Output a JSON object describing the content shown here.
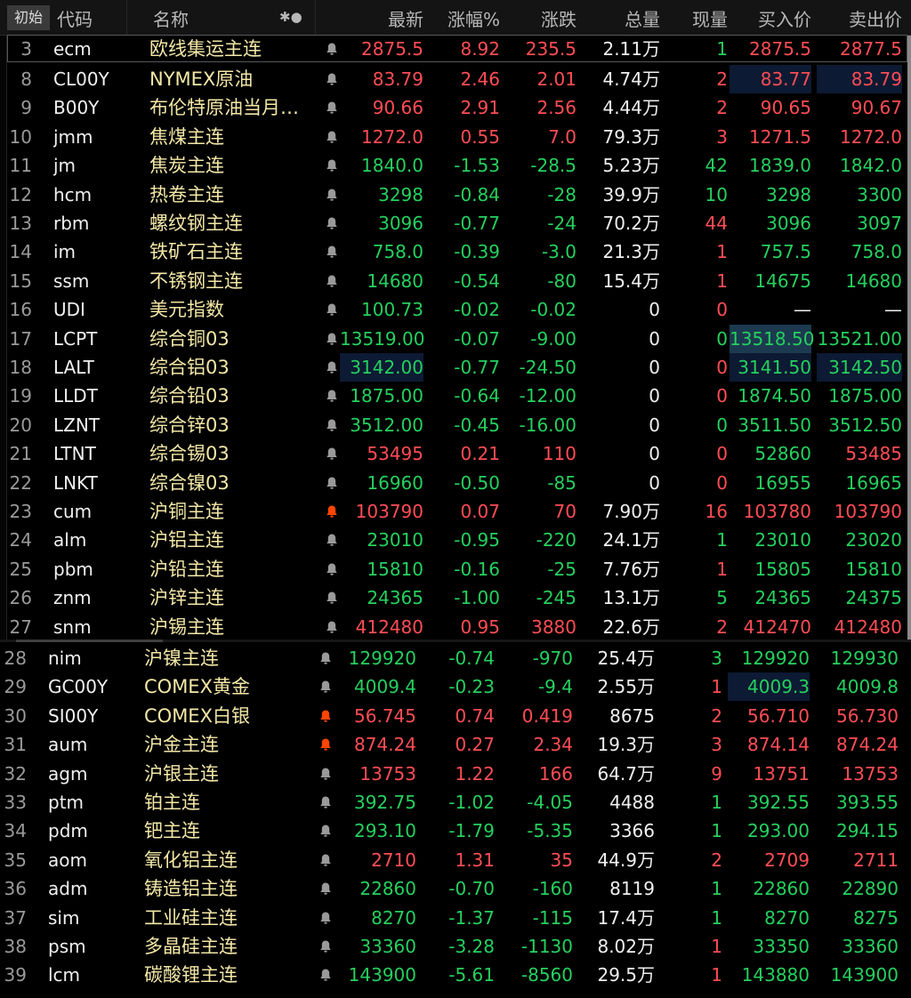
{
  "header": {
    "init_tab": "初始",
    "code": "代码",
    "name": "名称",
    "icons": "✱●",
    "latest": "最新",
    "change_pct": "涨幅%",
    "change": "涨跌",
    "volume": "总量",
    "current_vol": "现量",
    "bid": "买入价",
    "ask": "卖出价"
  },
  "colors": {
    "up": "#ff4d55",
    "down": "#25d05e",
    "name": "#f3e7a6",
    "bell_active": "#ff4500",
    "bell_idle": "#9a9a9a"
  },
  "rows": [
    {
      "num": "3",
      "code": "ecm",
      "name": "欧线集运主连",
      "bell": "idle",
      "latest": "2875.5",
      "pct": "8.92",
      "chg": "235.5",
      "vol": "2.11万",
      "cur": "1",
      "curdir": "down",
      "bid": "2875.5",
      "ask": "2877.5",
      "dir": "up"
    },
    {
      "num": "8",
      "code": "CL00Y",
      "name": "NYMEX原油",
      "bell": "idle",
      "latest": "83.79",
      "pct": "2.46",
      "chg": "2.01",
      "vol": "4.74万",
      "cur": "2",
      "curdir": "up",
      "bid": "83.77",
      "ask": "83.79",
      "dir": "up",
      "hl_bidask": true
    },
    {
      "num": "9",
      "code": "B00Y",
      "name": "布伦特原油当月…",
      "bell": "idle",
      "latest": "90.66",
      "pct": "2.91",
      "chg": "2.56",
      "vol": "4.44万",
      "cur": "2",
      "curdir": "up",
      "bid": "90.65",
      "ask": "90.67",
      "dir": "up"
    },
    {
      "num": "10",
      "code": "jmm",
      "name": "焦煤主连",
      "bell": "idle",
      "latest": "1272.0",
      "pct": "0.55",
      "chg": "7.0",
      "vol": "79.3万",
      "cur": "3",
      "curdir": "up",
      "bid": "1271.5",
      "ask": "1272.0",
      "dir": "up"
    },
    {
      "num": "11",
      "code": "jm",
      "name": "焦炭主连",
      "bell": "idle",
      "latest": "1840.0",
      "pct": "-1.53",
      "chg": "-28.5",
      "vol": "5.23万",
      "cur": "42",
      "curdir": "down",
      "bid": "1839.0",
      "ask": "1842.0",
      "dir": "down"
    },
    {
      "num": "12",
      "code": "hcm",
      "name": "热卷主连",
      "bell": "idle",
      "latest": "3298",
      "pct": "-0.84",
      "chg": "-28",
      "vol": "39.9万",
      "cur": "10",
      "curdir": "down",
      "bid": "3298",
      "ask": "3300",
      "dir": "down"
    },
    {
      "num": "13",
      "code": "rbm",
      "name": "螺纹钢主连",
      "bell": "idle",
      "latest": "3096",
      "pct": "-0.77",
      "chg": "-24",
      "vol": "70.2万",
      "cur": "44",
      "curdir": "up",
      "bid": "3096",
      "ask": "3097",
      "dir": "down"
    },
    {
      "num": "14",
      "code": "im",
      "name": "铁矿石主连",
      "bell": "idle",
      "latest": "758.0",
      "pct": "-0.39",
      "chg": "-3.0",
      "vol": "21.3万",
      "cur": "1",
      "curdir": "up",
      "bid": "757.5",
      "ask": "758.0",
      "dir": "down"
    },
    {
      "num": "15",
      "code": "ssm",
      "name": "不锈钢主连",
      "bell": "idle",
      "latest": "14680",
      "pct": "-0.54",
      "chg": "-80",
      "vol": "15.4万",
      "cur": "1",
      "curdir": "up",
      "bid": "14675",
      "ask": "14680",
      "dir": "down"
    },
    {
      "num": "16",
      "code": "UDI",
      "name": "美元指数",
      "bell": "idle",
      "latest": "100.73",
      "pct": "-0.02",
      "chg": "-0.02",
      "vol": "0",
      "cur": "0",
      "curdir": "up",
      "bid": "—",
      "ask": "—",
      "dir": "down",
      "biddir": "zero"
    },
    {
      "num": "17",
      "code": "LCPT",
      "name": "综合铜03",
      "bell": "idle",
      "latest": "13519.00",
      "pct": "-0.07",
      "chg": "-9.00",
      "vol": "0",
      "cur": "0",
      "curdir": "down",
      "bid": "13518.50",
      "ask": "13521.00",
      "dir": "down",
      "hl_bid_strong": true
    },
    {
      "num": "18",
      "code": "LALT",
      "name": "综合铝03",
      "bell": "idle",
      "latest": "3142.00",
      "pct": "-0.77",
      "chg": "-24.50",
      "vol": "0",
      "cur": "0",
      "curdir": "up",
      "bid": "3141.50",
      "ask": "3142.50",
      "dir": "down",
      "hl_latest": true,
      "hl_bidask": true
    },
    {
      "num": "19",
      "code": "LLDT",
      "name": "综合铅03",
      "bell": "idle",
      "latest": "1875.00",
      "pct": "-0.64",
      "chg": "-12.00",
      "vol": "0",
      "cur": "0",
      "curdir": "up",
      "bid": "1874.50",
      "ask": "1875.00",
      "dir": "down"
    },
    {
      "num": "20",
      "code": "LZNT",
      "name": "综合锌03",
      "bell": "idle",
      "latest": "3512.00",
      "pct": "-0.45",
      "chg": "-16.00",
      "vol": "0",
      "cur": "0",
      "curdir": "down",
      "bid": "3511.50",
      "ask": "3512.50",
      "dir": "down"
    },
    {
      "num": "21",
      "code": "LTNT",
      "name": "综合锡03",
      "bell": "idle",
      "latest": "53495",
      "pct": "0.21",
      "chg": "110",
      "vol": "0",
      "cur": "0",
      "curdir": "up",
      "bid": "52860",
      "ask": "53485",
      "dir": "up",
      "biddir": "down"
    },
    {
      "num": "22",
      "code": "LNKT",
      "name": "综合镍03",
      "bell": "idle",
      "latest": "16960",
      "pct": "-0.50",
      "chg": "-85",
      "vol": "0",
      "cur": "0",
      "curdir": "up",
      "bid": "16955",
      "ask": "16965",
      "dir": "down"
    },
    {
      "num": "23",
      "code": "cum",
      "name": "沪铜主连",
      "bell": "active",
      "latest": "103790",
      "pct": "0.07",
      "chg": "70",
      "vol": "7.90万",
      "cur": "16",
      "curdir": "up",
      "bid": "103780",
      "ask": "103790",
      "dir": "up"
    },
    {
      "num": "24",
      "code": "alm",
      "name": "沪铝主连",
      "bell": "idle",
      "latest": "23010",
      "pct": "-0.95",
      "chg": "-220",
      "vol": "24.1万",
      "cur": "1",
      "curdir": "down",
      "bid": "23010",
      "ask": "23020",
      "dir": "down"
    },
    {
      "num": "25",
      "code": "pbm",
      "name": "沪铅主连",
      "bell": "idle",
      "latest": "15810",
      "pct": "-0.16",
      "chg": "-25",
      "vol": "7.76万",
      "cur": "1",
      "curdir": "up",
      "bid": "15805",
      "ask": "15810",
      "dir": "down"
    },
    {
      "num": "26",
      "code": "znm",
      "name": "沪锌主连",
      "bell": "idle",
      "latest": "24365",
      "pct": "-1.00",
      "chg": "-245",
      "vol": "13.1万",
      "cur": "5",
      "curdir": "down",
      "bid": "24365",
      "ask": "24375",
      "dir": "down"
    },
    {
      "num": "27",
      "code": "snm",
      "name": "沪锡主连",
      "bell": "idle",
      "latest": "412480",
      "pct": "0.95",
      "chg": "3880",
      "vol": "22.6万",
      "cur": "2",
      "curdir": "up",
      "bid": "412470",
      "ask": "412480",
      "dir": "up"
    },
    {
      "num": "28",
      "code": "nim",
      "name": "沪镍主连",
      "bell": "idle",
      "latest": "129920",
      "pct": "-0.74",
      "chg": "-970",
      "vol": "25.4万",
      "cur": "3",
      "curdir": "down",
      "bid": "129920",
      "ask": "129930",
      "dir": "down"
    },
    {
      "num": "29",
      "code": "GC00Y",
      "name": "COMEX黄金",
      "bell": "idle",
      "latest": "4009.4",
      "pct": "-0.23",
      "chg": "-9.4",
      "vol": "2.55万",
      "cur": "1",
      "curdir": "up",
      "bid": "4009.3",
      "ask": "4009.8",
      "dir": "down",
      "hl_bid": true
    },
    {
      "num": "30",
      "code": "SI00Y",
      "name": "COMEX白银",
      "bell": "active",
      "latest": "56.745",
      "pct": "0.74",
      "chg": "0.419",
      "vol": "8675",
      "cur": "2",
      "curdir": "up",
      "bid": "56.710",
      "ask": "56.730",
      "dir": "up"
    },
    {
      "num": "31",
      "code": "aum",
      "name": "沪金主连",
      "bell": "active",
      "latest": "874.24",
      "pct": "0.27",
      "chg": "2.34",
      "vol": "19.3万",
      "cur": "3",
      "curdir": "up",
      "bid": "874.14",
      "ask": "874.24",
      "dir": "up"
    },
    {
      "num": "32",
      "code": "agm",
      "name": "沪银主连",
      "bell": "idle",
      "latest": "13753",
      "pct": "1.22",
      "chg": "166",
      "vol": "64.7万",
      "cur": "9",
      "curdir": "up",
      "bid": "13751",
      "ask": "13753",
      "dir": "up"
    },
    {
      "num": "33",
      "code": "ptm",
      "name": "铂主连",
      "bell": "idle",
      "latest": "392.75",
      "pct": "-1.02",
      "chg": "-4.05",
      "vol": "4488",
      "cur": "1",
      "curdir": "down",
      "bid": "392.55",
      "ask": "393.55",
      "dir": "down"
    },
    {
      "num": "34",
      "code": "pdm",
      "name": "钯主连",
      "bell": "idle",
      "latest": "293.10",
      "pct": "-1.79",
      "chg": "-5.35",
      "vol": "3366",
      "cur": "1",
      "curdir": "down",
      "bid": "293.00",
      "ask": "294.15",
      "dir": "down"
    },
    {
      "num": "35",
      "code": "aom",
      "name": "氧化铝主连",
      "bell": "idle",
      "latest": "2710",
      "pct": "1.31",
      "chg": "35",
      "vol": "44.9万",
      "cur": "2",
      "curdir": "up",
      "bid": "2709",
      "ask": "2711",
      "dir": "up"
    },
    {
      "num": "36",
      "code": "adm",
      "name": "铸造铝主连",
      "bell": "idle",
      "latest": "22860",
      "pct": "-0.70",
      "chg": "-160",
      "vol": "8119",
      "cur": "1",
      "curdir": "down",
      "bid": "22860",
      "ask": "22890",
      "dir": "down"
    },
    {
      "num": "37",
      "code": "sim",
      "name": "工业硅主连",
      "bell": "idle",
      "latest": "8270",
      "pct": "-1.37",
      "chg": "-115",
      "vol": "17.4万",
      "cur": "1",
      "curdir": "down",
      "bid": "8270",
      "ask": "8275",
      "dir": "down"
    },
    {
      "num": "38",
      "code": "psm",
      "name": "多晶硅主连",
      "bell": "idle",
      "latest": "33360",
      "pct": "-3.28",
      "chg": "-1130",
      "vol": "8.02万",
      "cur": "1",
      "curdir": "up",
      "bid": "33350",
      "ask": "33360",
      "dir": "down"
    },
    {
      "num": "39",
      "code": "lcm",
      "name": "碳酸锂主连",
      "bell": "idle",
      "latest": "143900",
      "pct": "-5.61",
      "chg": "-8560",
      "vol": "29.5万",
      "cur": "1",
      "curdir": "up",
      "bid": "143880",
      "ask": "143900",
      "dir": "down"
    }
  ]
}
